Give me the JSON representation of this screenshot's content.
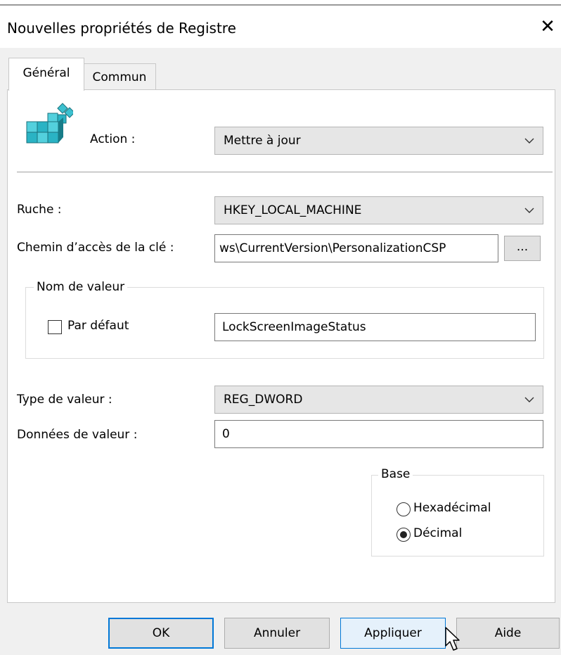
{
  "window": {
    "title": "Nouvelles propriétés de Registre",
    "close_glyph": "✕"
  },
  "tabs": [
    {
      "label": "Général",
      "active": true
    },
    {
      "label": "Commun",
      "active": false
    }
  ],
  "general": {
    "action_label": "Action :",
    "action_value": "Mettre à jour",
    "hive_label": "Ruche :",
    "hive_value": "HKEY_LOCAL_MACHINE",
    "key_path_label": "Chemin d’accès de la clé :",
    "key_path_value": "ws\\CurrentVersion\\PersonalizationCSP",
    "browse_label": "...",
    "value_name_group": "Nom de valeur",
    "default_label": "Par défaut",
    "default_checked": false,
    "value_name": "LockScreenImageStatus",
    "value_type_label": "Type de valeur :",
    "value_type": "REG_DWORD",
    "value_data_label": "Données de valeur :",
    "value_data": "0",
    "base_group": "Base",
    "base_options": [
      {
        "label": "Hexadécimal",
        "checked": false
      },
      {
        "label": "Décimal",
        "checked": true
      }
    ]
  },
  "buttons": {
    "ok": "OK",
    "cancel": "Annuler",
    "apply": "Appliquer",
    "help": "Aide"
  },
  "icons": {
    "registry": "registry-blocks-icon",
    "dropdown": "chevron-down-icon",
    "cursor": "mouse-pointer-icon"
  },
  "colors": {
    "accent": "#0078d7",
    "icon_teal": "#2ab3c4",
    "panel_bg": "#f0f0f0"
  }
}
